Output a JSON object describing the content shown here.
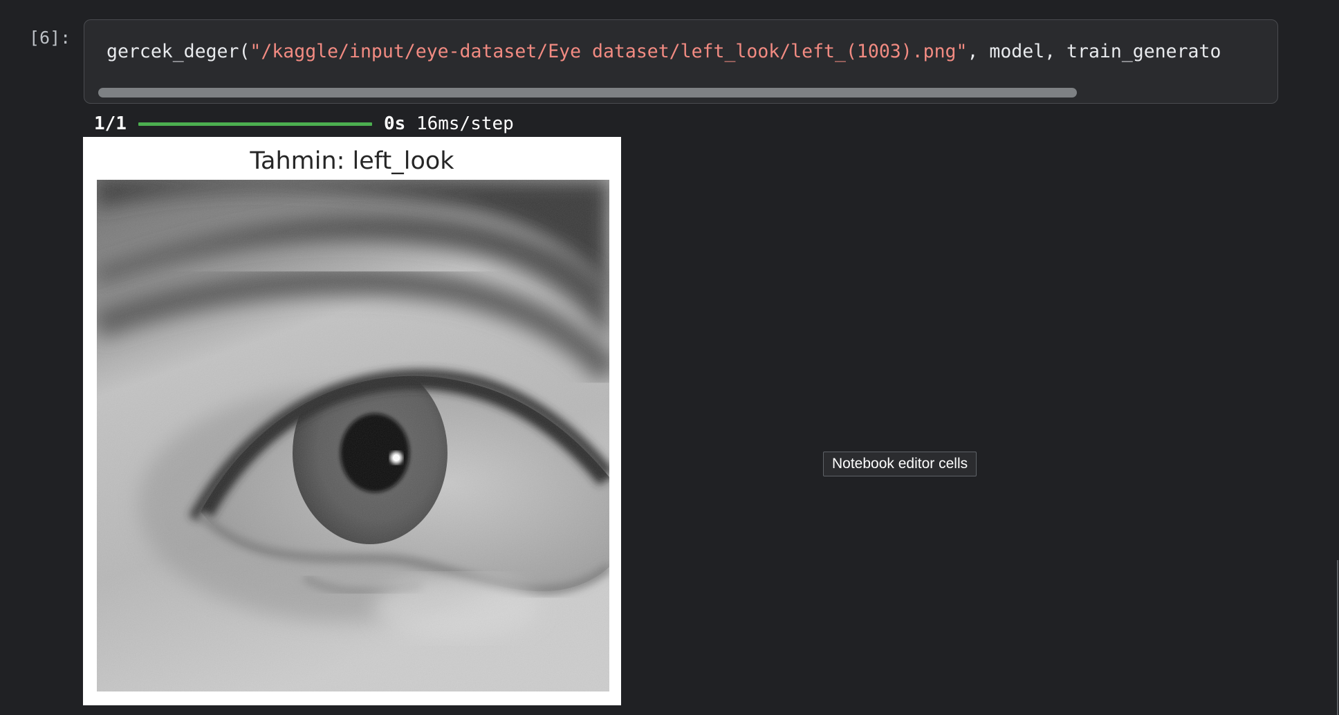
{
  "cell": {
    "prompt": "[6]:",
    "code": {
      "prefix": "gercek_deger(",
      "path_string": "\"/kaggle/input/eye-dataset/Eye dataset/left_look/left_(1003).png\"",
      "suffix": ", model, train_generato"
    },
    "scrollbar": {
      "thumb_fraction": 0.84
    }
  },
  "output": {
    "progress": {
      "count": "1/1",
      "fraction": 1.0,
      "time": "0s",
      "rate": "16ms/step"
    },
    "figure": {
      "title": "Tahmin: left_look"
    }
  },
  "tooltip": {
    "text": "Notebook editor cells"
  },
  "colors": {
    "background": "#202124",
    "cell_background": "#2a2b2e",
    "string_literal": "#f28b82",
    "progress_bar": "#4caf50"
  }
}
